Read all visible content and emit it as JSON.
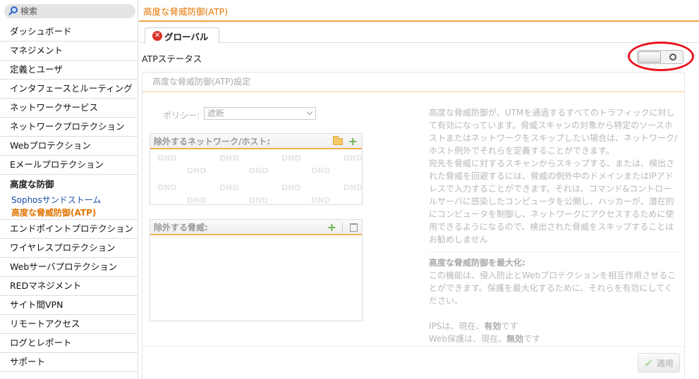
{
  "search": {
    "placeholder": "検索",
    "icon": "search-icon"
  },
  "sidebar": {
    "items_top": [
      "ダッシュボード",
      "マネジメント",
      "定義とユーザ",
      "インタフェースとルーティング",
      "ネットワークサービス",
      "ネットワークプロテクション",
      "Webプロテクション",
      "Eメールプロテクション"
    ],
    "group": {
      "title": "高度な防御",
      "subs": [
        "Sophosサンドストーム",
        "高度な脅威防御(ATP)"
      ],
      "active_index": 1
    },
    "items_bottom": [
      "エンドポイントプロテクション",
      "ワイヤレスプロテクション",
      "Webサーバプロテクション",
      "REDマネジメント",
      "サイト間VPN",
      "リモートアクセス",
      "ログとレポート",
      "サポート"
    ]
  },
  "header": {
    "title": "高度な脅威防御(ATP)"
  },
  "tabs": [
    {
      "label": "グローバル",
      "icon": "close-circle-icon",
      "color": "#d9332b"
    }
  ],
  "atp": {
    "status_label": "ATPステータス",
    "toggle_state": "off"
  },
  "panel": {
    "title": "高度な脅威防御(ATP)設定",
    "policy_label": "ポリシー:",
    "policy_value": "遮断",
    "exclude_network_title": "除外するネットワーク/ホスト:",
    "exclude_threat_title": "除外する脅威:",
    "dnd_text": "DND",
    "apply_label": "適用"
  },
  "help": {
    "p1": "高度な脅威防御が、UTMを通過するすべてのトラフィックに対して有効になっています。脅威スキャンの対象から特定のソースホストまたはネットワークをスキップしたい場合は、ネットワーク/ホスト例外でそれらを定義することができます。",
    "p2": "宛先を脅威に対するスキャンからスキップする、または、検出された脅威を回避するには、脅威の例外中のドメインまたはIPアドレスで入力することができます。それは、コマンド&コントロールサーバに感染したコンピュータを公開し、ハッカーが、潜在的にコンピュータを制御し、ネットワークにアクセスするために使用できるようになるので、検出された脅威をスキップすることはお勧めしません",
    "max_title": "高度な脅威防御を最大化:",
    "max_text": "この機能は、侵入防止とWebプロテクションを相互作用させることができます。保護を最大化するために、それらを有効にしてください。",
    "ips_prefix": "IPSは、現在、",
    "ips_state": "有効",
    "ips_suffix": "です",
    "web_prefix": "Web保護は、現在、",
    "web_state": "無効",
    "web_suffix": "です"
  },
  "colors": {
    "accent": "#e07400",
    "highlight": "#e8141e"
  }
}
